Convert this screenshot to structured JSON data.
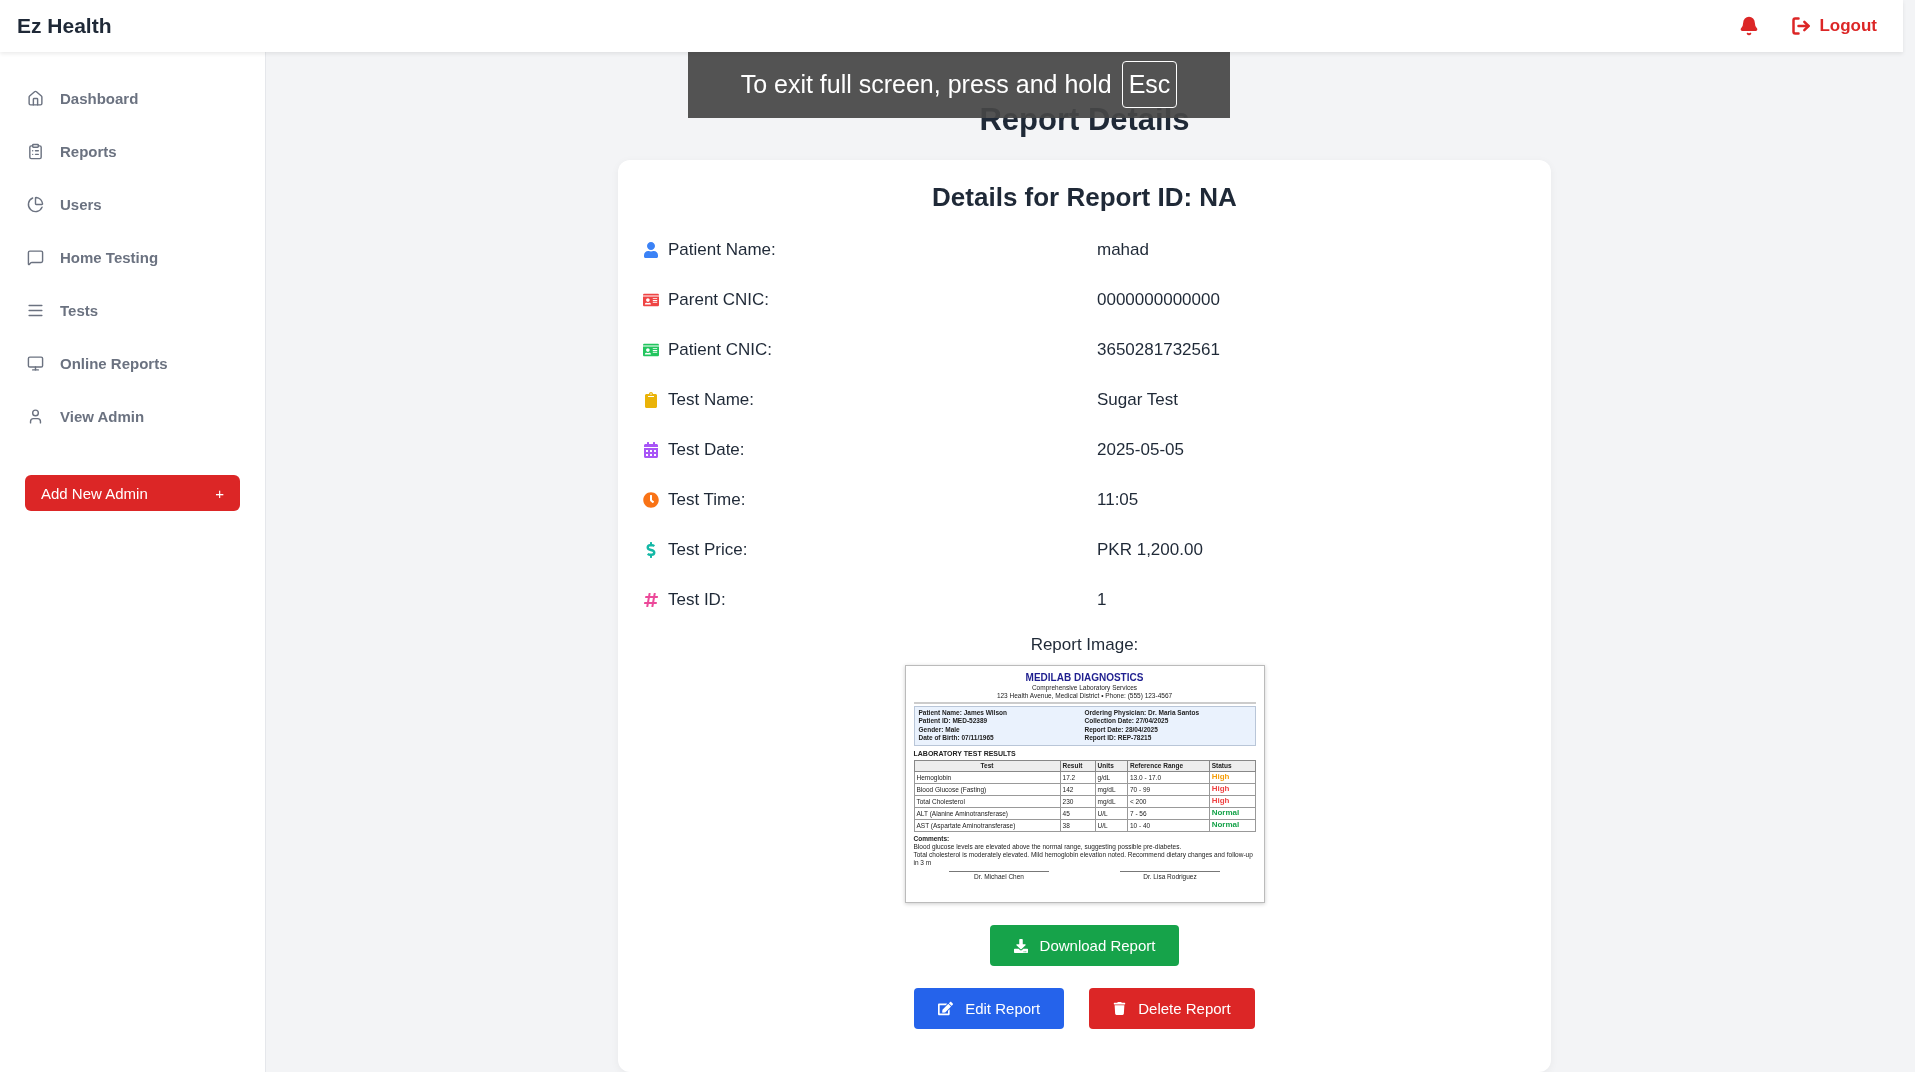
{
  "header": {
    "brand": "Ez Health",
    "logout": "Logout"
  },
  "sidebar": {
    "items": [
      {
        "label": "Dashboard",
        "selected": false
      },
      {
        "label": "Reports",
        "selected": false
      },
      {
        "label": "Users",
        "selected": false
      },
      {
        "label": "Home Testing",
        "selected": false
      },
      {
        "label": "Tests",
        "selected": false
      },
      {
        "label": "Online Reports",
        "selected": false
      },
      {
        "label": "View Admin",
        "selected": false
      }
    ],
    "add_button": {
      "label": "Add New Admin",
      "symbol": "+"
    }
  },
  "page_title": "Report Details",
  "fullscreen_notice": {
    "text": "To exit full screen, press and hold",
    "key": "Esc"
  },
  "card": {
    "title": "Details for Report ID: NA",
    "fields": [
      {
        "label": "Patient Name:",
        "value": "mahad",
        "color": "#3b82f6"
      },
      {
        "label": "Parent CNIC:",
        "value": "0000000000000",
        "color": "#ef4444"
      },
      {
        "label": "Patient CNIC:",
        "value": "3650281732561",
        "color": "#22c55e"
      },
      {
        "label": "Test Name:",
        "value": "Sugar Test",
        "color": "#eab308"
      },
      {
        "label": "Test Date:",
        "value": "2025-05-05",
        "color": "#a855f7"
      },
      {
        "label": "Test Time:",
        "value": "11:05",
        "color": "#f97316"
      },
      {
        "label": "Test Price:",
        "value": "PKR 1,200.00",
        "color": "#14b8a6"
      },
      {
        "label": "Test ID:",
        "value": "1",
        "color": "#ec4899"
      }
    ],
    "image_label": "Report Image:",
    "report_document": {
      "lab": "MEDILAB DIAGNOSTICS",
      "subtitle": "Comprehensive Laboratory Services",
      "address": "123 Health Avenue, Medical District • Phone: (555) 123-4567",
      "info_left": [
        "Patient Name: James Wilson",
        "Patient ID: MED-52389",
        "Gender: Male",
        "Date of Birth: 07/11/1965"
      ],
      "info_right": [
        "Ordering Physician: Dr. Maria Santos",
        "Collection Date: 27/04/2025",
        "Report Date: 28/04/2025",
        "Report ID: REP-78215"
      ],
      "section_title": "LABORATORY TEST RESULTS",
      "columns": [
        "Test",
        "Result",
        "Units",
        "Reference Range",
        "Status"
      ],
      "rows": [
        {
          "test": "Hemoglobin",
          "result": "17.2",
          "units": "g/dL",
          "range": "13.0 - 17.0",
          "status": "High",
          "color": "#f59e0b"
        },
        {
          "test": "Blood Glucose (Fasting)",
          "result": "142",
          "units": "mg/dL",
          "range": "70 - 99",
          "status": "High",
          "color": "#ef4444"
        },
        {
          "test": "Total Cholesterol",
          "result": "230",
          "units": "mg/dL",
          "range": "< 200",
          "status": "High",
          "color": "#ef4444"
        },
        {
          "test": "ALT (Alanine Aminotransferase)",
          "result": "45",
          "units": "U/L",
          "range": "7 - 56",
          "status": "Normal",
          "color": "#16a34a"
        },
        {
          "test": "AST (Aspartate Aminotransferase)",
          "result": "38",
          "units": "U/L",
          "range": "10 - 40",
          "status": "Normal",
          "color": "#16a34a"
        }
      ],
      "comments_title": "Comments:",
      "comments": [
        "Blood glucose levels are elevated above the normal range, suggesting possible pre-diabetes.",
        "Total cholesterol is moderately elevated. Mild hemoglobin elevation noted. Recommend dietary changes and follow-up in 3 m"
      ],
      "signatures": [
        "Dr. Michael Chen",
        "Dr. Lisa Rodriguez"
      ]
    },
    "buttons": {
      "download": "Download Report",
      "edit": "Edit Report",
      "delete": "Delete Report"
    }
  }
}
